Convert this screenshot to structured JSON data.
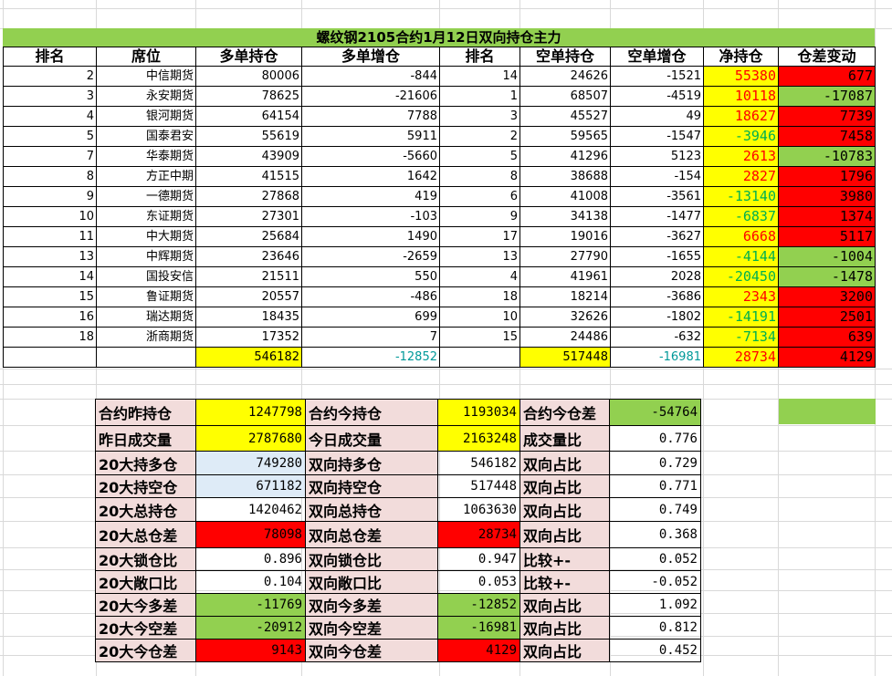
{
  "title": "螺纹钢2105合约1月12日双向持仓主力",
  "headers": [
    "排名",
    "席位",
    "多单持仓",
    "多单增仓",
    "排名",
    "空单持仓",
    "空单增仓",
    "净持仓",
    "仓差变动"
  ],
  "rows": [
    {
      "rank": "2",
      "seat": "中信期货",
      "long": "80006",
      "long_chg": "-844",
      "srank": "14",
      "short": "24626",
      "short_chg": "-1521",
      "net": "55380",
      "net_pos": true,
      "diff": "677",
      "diff_pos": true
    },
    {
      "rank": "3",
      "seat": "永安期货",
      "long": "78625",
      "long_chg": "-21606",
      "srank": "1",
      "short": "68507",
      "short_chg": "-4519",
      "net": "10118",
      "net_pos": true,
      "diff": "-17087",
      "diff_pos": false
    },
    {
      "rank": "4",
      "seat": "银河期货",
      "long": "64154",
      "long_chg": "7788",
      "srank": "3",
      "short": "45527",
      "short_chg": "49",
      "net": "18627",
      "net_pos": true,
      "diff": "7739",
      "diff_pos": true
    },
    {
      "rank": "5",
      "seat": "国泰君安",
      "long": "55619",
      "long_chg": "5911",
      "srank": "2",
      "short": "59565",
      "short_chg": "-1547",
      "net": "-3946",
      "net_pos": false,
      "diff": "7458",
      "diff_pos": true
    },
    {
      "rank": "7",
      "seat": "华泰期货",
      "long": "43909",
      "long_chg": "-5660",
      "srank": "5",
      "short": "41296",
      "short_chg": "5123",
      "net": "2613",
      "net_pos": true,
      "diff": "-10783",
      "diff_pos": false
    },
    {
      "rank": "8",
      "seat": "方正中期",
      "long": "41515",
      "long_chg": "1642",
      "srank": "8",
      "short": "38688",
      "short_chg": "-154",
      "net": "2827",
      "net_pos": true,
      "diff": "1796",
      "diff_pos": true
    },
    {
      "rank": "9",
      "seat": "一德期货",
      "long": "27868",
      "long_chg": "419",
      "srank": "6",
      "short": "41008",
      "short_chg": "-3561",
      "net": "-13140",
      "net_pos": false,
      "diff": "3980",
      "diff_pos": true
    },
    {
      "rank": "10",
      "seat": "东证期货",
      "long": "27301",
      "long_chg": "-103",
      "srank": "9",
      "short": "34138",
      "short_chg": "-1477",
      "net": "-6837",
      "net_pos": false,
      "diff": "1374",
      "diff_pos": true
    },
    {
      "rank": "11",
      "seat": "中大期货",
      "long": "25684",
      "long_chg": "1490",
      "srank": "17",
      "short": "19016",
      "short_chg": "-3627",
      "net": "6668",
      "net_pos": true,
      "diff": "5117",
      "diff_pos": true
    },
    {
      "rank": "13",
      "seat": "中辉期货",
      "long": "23646",
      "long_chg": "-2659",
      "srank": "13",
      "short": "27790",
      "short_chg": "-1655",
      "net": "-4144",
      "net_pos": false,
      "diff": "-1004",
      "diff_pos": false
    },
    {
      "rank": "14",
      "seat": "国投安信",
      "long": "21511",
      "long_chg": "550",
      "srank": "4",
      "short": "41961",
      "short_chg": "2028",
      "net": "-20450",
      "net_pos": false,
      "diff": "-1478",
      "diff_pos": false
    },
    {
      "rank": "15",
      "seat": "鲁证期货",
      "long": "20557",
      "long_chg": "-486",
      "srank": "18",
      "short": "18214",
      "short_chg": "-3686",
      "net": "2343",
      "net_pos": true,
      "diff": "3200",
      "diff_pos": true
    },
    {
      "rank": "16",
      "seat": "瑞达期货",
      "long": "18435",
      "long_chg": "699",
      "srank": "10",
      "short": "32626",
      "short_chg": "-1802",
      "net": "-14191",
      "net_pos": false,
      "diff": "2501",
      "diff_pos": true
    },
    {
      "rank": "18",
      "seat": "浙商期货",
      "long": "17352",
      "long_chg": "7",
      "srank": "15",
      "short": "24486",
      "short_chg": "-632",
      "net": "-7134",
      "net_pos": false,
      "diff": "639",
      "diff_pos": true
    }
  ],
  "totals": {
    "long": "546182",
    "long_chg": "-12852",
    "short": "517448",
    "short_chg": "-16981",
    "net": "28734",
    "diff": "4129"
  },
  "summary": [
    {
      "l1": "合约昨持仓",
      "v1": "1247798",
      "c1": "yel",
      "l2": "合约今持仓",
      "v2": "1193034",
      "c2": "yel",
      "l3": "合约今仓差",
      "v3": "-54764",
      "c3": "grn",
      "r3": false
    },
    {
      "l1": "昨日成交量",
      "v1": "2787680",
      "c1": "yel",
      "l2": "今日成交量",
      "v2": "2163248",
      "c2": "yel",
      "l3": "成交量比",
      "v3": "0.776",
      "c3": "",
      "r3": true
    },
    {
      "l1": "20大持多仓",
      "v1": "749280",
      "c1": "lblue",
      "l2": "双向持多仓",
      "v2": "546182",
      "c2": "",
      "l3": "双向占比",
      "v3": "0.729",
      "c3": "",
      "r3": true
    },
    {
      "l1": "20大持空仓",
      "v1": "671182",
      "c1": "lblue",
      "l2": "双向持空仓",
      "v2": "517448",
      "c2": "",
      "l3": "双向占比",
      "v3": "0.771",
      "c3": "",
      "r3": true
    },
    {
      "l1": "20大总持仓",
      "v1": "1420462",
      "c1": "",
      "l2": "双向总持仓",
      "v2": "1063630",
      "c2": "",
      "l3": "双向占比",
      "v3": "0.749",
      "c3": "",
      "r3": true
    },
    {
      "l1": "20大总仓差",
      "v1": "78098",
      "c1": "red",
      "l2": "双向总仓差",
      "v2": "28734",
      "c2": "red",
      "l3": "双向占比",
      "v3": "0.368",
      "c3": "",
      "r3": true
    },
    {
      "l1": "20大锁仓比",
      "v1": "0.896",
      "c1": "",
      "l2": "双向锁仓比",
      "v2": "0.947",
      "c2": "",
      "l3": "比较+-",
      "v3": "0.052",
      "c3": "",
      "r3": true
    },
    {
      "l1": "20大敞口比",
      "v1": "0.104",
      "c1": "",
      "l2": "双向敞口比",
      "v2": "0.053",
      "c2": "",
      "l3": "比较+-",
      "v3": "-0.052",
      "c3": "",
      "r3": true
    },
    {
      "l1": "20大今多差",
      "v1": "-11769",
      "c1": "grn",
      "l2": "双向今多差",
      "v2": "-12852",
      "c2": "grn",
      "l3": "双向占比",
      "v3": "1.092",
      "c3": "",
      "r3": true
    },
    {
      "l1": "20大今空差",
      "v1": "-20912",
      "c1": "grn",
      "l2": "双向今空差",
      "v2": "-16981",
      "c2": "grn",
      "l3": "双向占比",
      "v3": "0.812",
      "c3": "",
      "r3": true
    },
    {
      "l1": "20大今仓差",
      "v1": "9143",
      "c1": "red",
      "l2": "双向今仓差",
      "v2": "4129",
      "c2": "red",
      "l3": "双向占比",
      "v3": "0.452",
      "c3": "",
      "r3": true
    }
  ]
}
